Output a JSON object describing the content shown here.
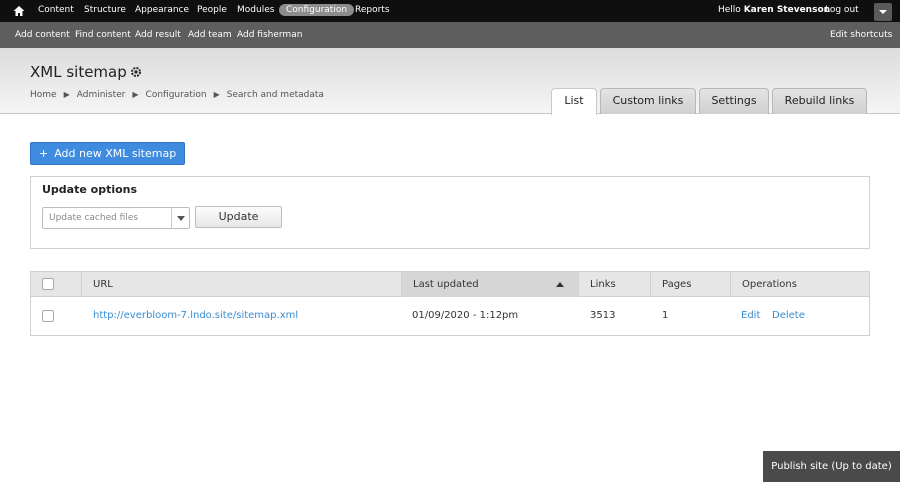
{
  "toolbar": {
    "home_icon": "home-icon",
    "menu": [
      {
        "label": "Content"
      },
      {
        "label": "Structure"
      },
      {
        "label": "Appearance"
      },
      {
        "label": "People"
      },
      {
        "label": "Modules"
      },
      {
        "label": "Configuration",
        "active": true
      },
      {
        "label": "Reports"
      }
    ],
    "hello_prefix": "Hello",
    "user_name": "Karen Stevenson",
    "logout": "Log out"
  },
  "shortcuts": {
    "items": [
      "Add content",
      "Find content",
      "Add result",
      "Add team",
      "Add fisherman"
    ],
    "edit": "Edit shortcuts"
  },
  "page": {
    "title": "XML sitemap",
    "breadcrumb": [
      "Home",
      "Administer",
      "Configuration",
      "Search and metadata"
    ],
    "tabs": [
      "List",
      "Custom links",
      "Settings",
      "Rebuild links"
    ],
    "active_tab": "List"
  },
  "add_button": {
    "plus": "+",
    "label": "Add new XML sitemap"
  },
  "update_options": {
    "legend": "Update options",
    "select_value": "Update cached files",
    "button": "Update"
  },
  "table": {
    "headers": [
      "URL",
      "Last updated",
      "Links",
      "Pages",
      "Operations"
    ],
    "rows": [
      {
        "url": "http://everbloom-7.lndo.site/sitemap.xml",
        "last_updated": "01/09/2020 - 1:12pm",
        "links": "3513",
        "pages": "1",
        "edit": "Edit",
        "delete": "Delete"
      }
    ]
  },
  "publish": "Publish site (Up to date)",
  "colors": {
    "accent": "#3f8be0",
    "link": "#3a8ccf",
    "toolbar": "#0f0f0f",
    "shortcuts": "#5e5e5e"
  }
}
